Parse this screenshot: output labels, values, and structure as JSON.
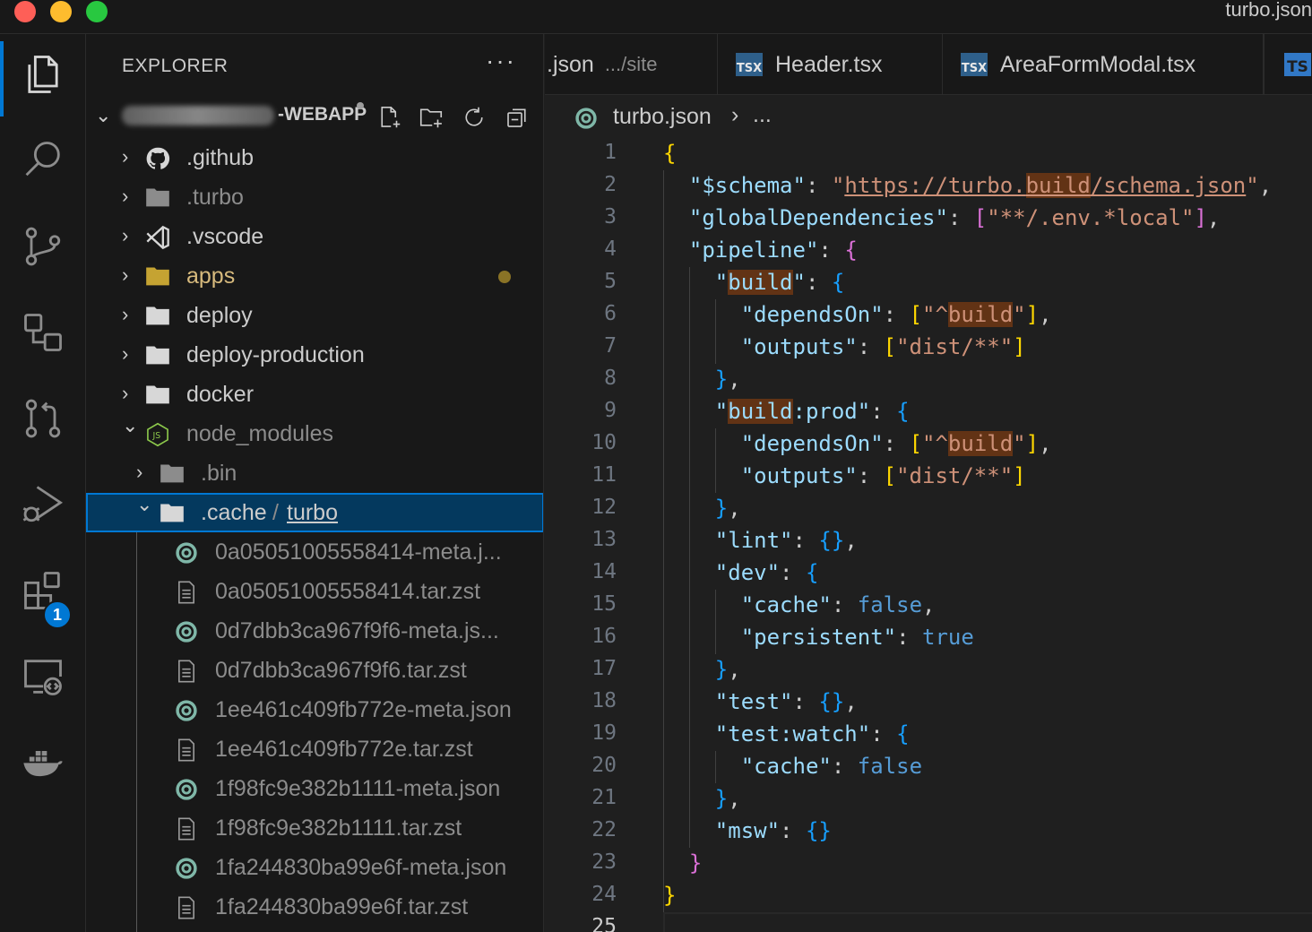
{
  "window": {
    "title": "turbo.json"
  },
  "activity_bar": {
    "items": [
      {
        "name": "explorer",
        "icon": "files-icon",
        "active": true
      },
      {
        "name": "search",
        "icon": "search-icon"
      },
      {
        "name": "source-control",
        "icon": "source-control-icon"
      },
      {
        "name": "remote-explorer",
        "icon": "remote-explorer-icon"
      },
      {
        "name": "pull-requests",
        "icon": "pull-request-icon"
      },
      {
        "name": "run-debug",
        "icon": "run-debug-icon"
      },
      {
        "name": "extensions",
        "icon": "extensions-icon",
        "badge": "1"
      },
      {
        "name": "remote",
        "icon": "remote-window-icon"
      },
      {
        "name": "docker",
        "icon": "docker-icon"
      }
    ]
  },
  "sidebar": {
    "title": "EXPLORER",
    "more": "···",
    "workspace": {
      "name": "-WEBAPP",
      "actions": [
        "new-file-icon",
        "new-folder-icon",
        "refresh-icon",
        "collapse-all-icon"
      ]
    },
    "tree": [
      {
        "label": ".github",
        "type": "folder",
        "icon": "github-icon",
        "depth": 0,
        "expanded": false
      },
      {
        "label": ".turbo",
        "type": "folder",
        "icon": "folder-icon",
        "depth": 0,
        "expanded": false,
        "dim": true
      },
      {
        "label": ".vscode",
        "type": "folder",
        "icon": "vscode-icon",
        "depth": 0,
        "expanded": false
      },
      {
        "label": "apps",
        "type": "folder",
        "icon": "folder-icon",
        "depth": 0,
        "expanded": false,
        "modified": true
      },
      {
        "label": "deploy",
        "type": "folder",
        "icon": "folder-icon",
        "depth": 0,
        "expanded": false
      },
      {
        "label": "deploy-production",
        "type": "folder",
        "icon": "folder-icon",
        "depth": 0,
        "expanded": false
      },
      {
        "label": "docker",
        "type": "folder",
        "icon": "folder-icon",
        "depth": 0,
        "expanded": false
      },
      {
        "label": "node_modules",
        "type": "folder",
        "icon": "nodejs-icon",
        "depth": 0,
        "expanded": true,
        "dim": true
      },
      {
        "label": ".bin",
        "type": "folder",
        "icon": "folder-icon",
        "depth": 1,
        "expanded": false,
        "dim": true
      },
      {
        "label": ".cache",
        "label_suffix": "turbo",
        "type": "folder",
        "icon": "folder-icon",
        "depth": 1,
        "expanded": true,
        "selected": true
      },
      {
        "label": "0a05051005558414-meta.j...",
        "type": "file",
        "icon": "turbo-icon",
        "depth": 2,
        "dim": true
      },
      {
        "label": "0a05051005558414.tar.zst",
        "type": "file",
        "icon": "file-text-icon",
        "depth": 2,
        "dim": true
      },
      {
        "label": "0d7dbb3ca967f9f6-meta.js...",
        "type": "file",
        "icon": "turbo-icon",
        "depth": 2,
        "dim": true
      },
      {
        "label": "0d7dbb3ca967f9f6.tar.zst",
        "type": "file",
        "icon": "file-text-icon",
        "depth": 2,
        "dim": true
      },
      {
        "label": "1ee461c409fb772e-meta.json",
        "type": "file",
        "icon": "turbo-icon",
        "depth": 2,
        "dim": true
      },
      {
        "label": "1ee461c409fb772e.tar.zst",
        "type": "file",
        "icon": "file-text-icon",
        "depth": 2,
        "dim": true
      },
      {
        "label": "1f98fc9e382b1111-meta.json",
        "type": "file",
        "icon": "turbo-icon",
        "depth": 2,
        "dim": true
      },
      {
        "label": "1f98fc9e382b1111.tar.zst",
        "type": "file",
        "icon": "file-text-icon",
        "depth": 2,
        "dim": true
      },
      {
        "label": "1fa244830ba99e6f-meta.json",
        "type": "file",
        "icon": "turbo-icon",
        "depth": 2,
        "dim": true
      },
      {
        "label": "1fa244830ba99e6f.tar.zst",
        "type": "file",
        "icon": "file-text-icon",
        "depth": 2,
        "dim": true
      }
    ]
  },
  "tabs": [
    {
      "name": ".json",
      "description": ".../site",
      "icon": "none"
    },
    {
      "name": "Header.tsx",
      "description": "",
      "icon": "tsx-icon",
      "icon_text": "TSX"
    },
    {
      "name": "AreaFormModal.tsx",
      "description": "",
      "icon": "tsx-icon",
      "icon_text": "TSX"
    },
    {
      "name": "",
      "description": "",
      "icon": "ts-icon",
      "icon_text": "TS"
    }
  ],
  "breadcrumb": {
    "file": "turbo.json",
    "separator": "›",
    "more": "..."
  },
  "editor": {
    "current_line": 25,
    "line_numbers": [
      "1",
      "2",
      "3",
      "4",
      "5",
      "6",
      "7",
      "8",
      "9",
      "10",
      "11",
      "12",
      "13",
      "14",
      "15",
      "16",
      "17",
      "18",
      "19",
      "20",
      "21",
      "22",
      "23",
      "24",
      "25"
    ]
  },
  "colors": {
    "accent": "#0078d4",
    "key": "#9cdcfe",
    "string": "#ce9178",
    "keyword": "#569cd6",
    "bracket_1": "#ffd700",
    "bracket_2": "#da70d6",
    "bracket_3": "#179fff",
    "modified": "#8a7326"
  }
}
